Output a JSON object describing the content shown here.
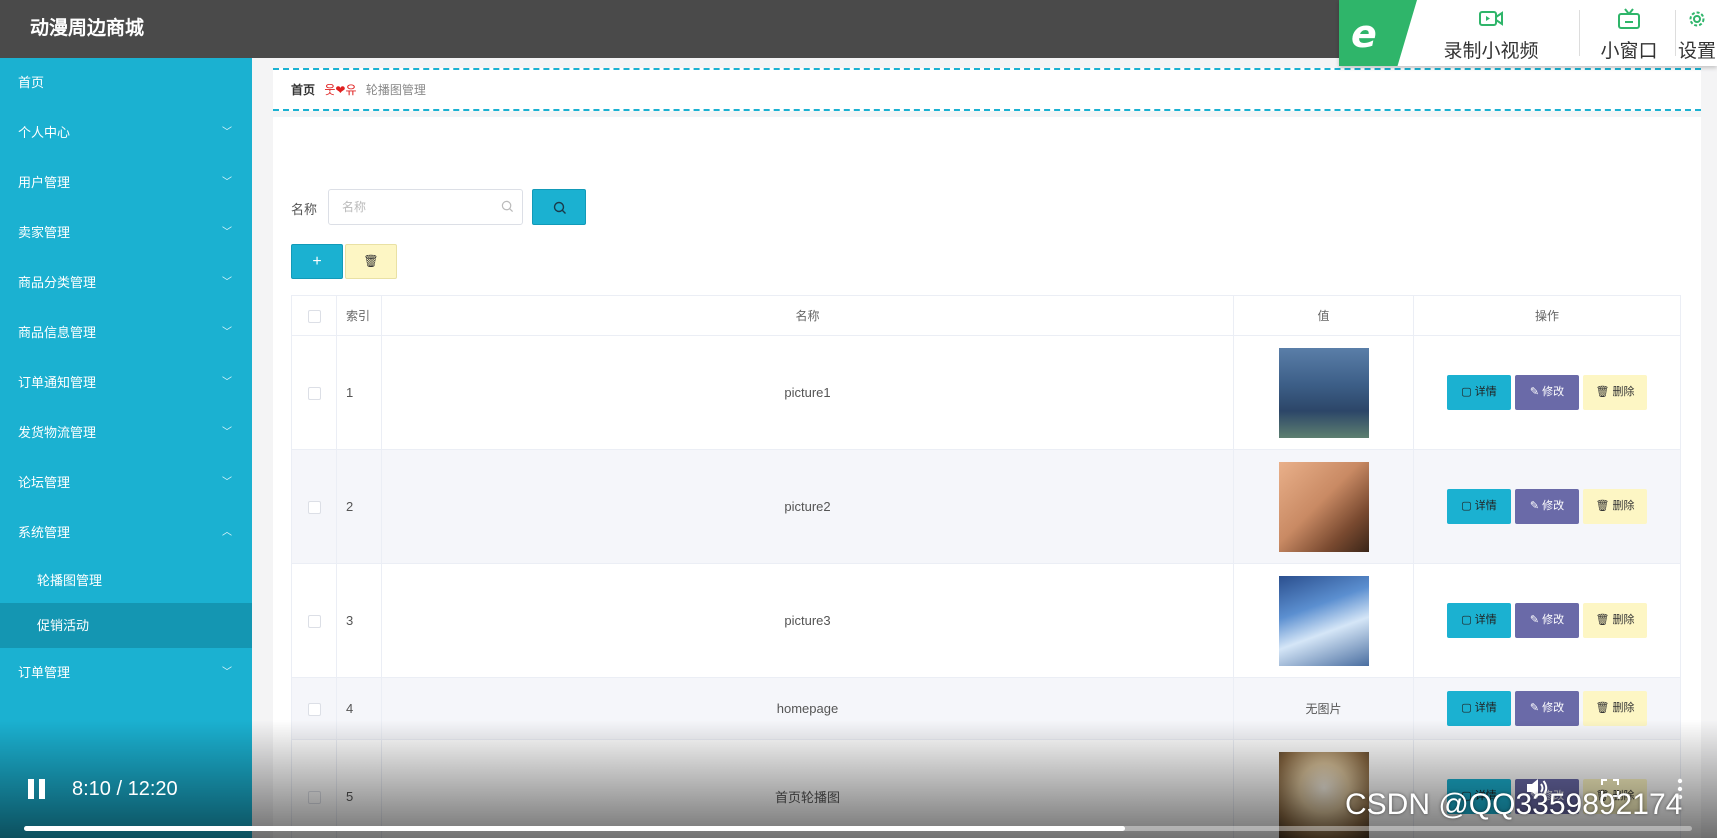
{
  "app": {
    "title": "动漫周边商城"
  },
  "toolbar": {
    "record_label": "录制小视频",
    "window_label": "小窗口",
    "settings_label": "设置"
  },
  "sidebar": {
    "items": [
      {
        "label": "首页"
      },
      {
        "label": "个人中心"
      },
      {
        "label": "用户管理"
      },
      {
        "label": "卖家管理"
      },
      {
        "label": "商品分类管理"
      },
      {
        "label": "商品信息管理"
      },
      {
        "label": "订单通知管理"
      },
      {
        "label": "发货物流管理"
      },
      {
        "label": "论坛管理"
      },
      {
        "label": "系统管理"
      }
    ],
    "sub_items": [
      {
        "label": "轮播图管理"
      },
      {
        "label": "促销活动"
      }
    ],
    "last_item": {
      "label": "订单管理"
    }
  },
  "breadcrumb": {
    "home": "首页",
    "separator": "웃❤유",
    "current": "轮播图管理"
  },
  "search": {
    "label": "名称",
    "placeholder": "名称",
    "value": ""
  },
  "actions": {
    "add_label": "+",
    "delete_label": "🗑"
  },
  "table": {
    "headers": [
      "索引",
      "名称",
      "值",
      "操作"
    ],
    "rows": [
      {
        "index": "1",
        "name": "picture1",
        "value": "image"
      },
      {
        "index": "2",
        "name": "picture2",
        "value": "image"
      },
      {
        "index": "3",
        "name": "picture3",
        "value": "image"
      },
      {
        "index": "4",
        "name": "homepage",
        "value": "无图片"
      },
      {
        "index": "5",
        "name": "首页轮播图",
        "value": "image"
      }
    ],
    "op_detail": "▢ 详情",
    "op_edit": "✎ 修改",
    "op_delete": "🗑 删除"
  },
  "player": {
    "time": "8:10 / 12:20",
    "progress": 0.66,
    "watermark": "CSDN @QQ3359892174"
  },
  "colors": {
    "accent": "#1bb1d1",
    "edit_button": "#6a6aa8",
    "delete_button": "#fdf6c4",
    "topbar": "#4a4a4a"
  }
}
